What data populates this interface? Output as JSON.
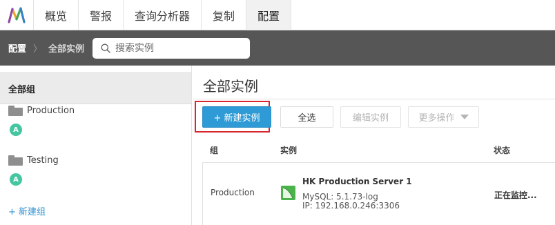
{
  "nav": {
    "tabs": [
      "概览",
      "警报",
      "查询分析器",
      "复制",
      "配置"
    ],
    "active_index": 4
  },
  "subbar": {
    "crumb_root": "配置",
    "crumb_sep": "〉",
    "crumb_current": "全部实例",
    "search_placeholder": "搜索实例"
  },
  "sidebar": {
    "all_groups": "全部组",
    "groups": [
      {
        "name": "Production",
        "avatar": "A"
      },
      {
        "name": "Testing",
        "avatar": "A"
      }
    ],
    "new_group": "+ 新建组"
  },
  "main": {
    "title": "全部实例",
    "buttons": {
      "new_instance": "+ 新建实例",
      "select_all": "全选",
      "edit_instance": "编辑实例",
      "more_actions": "更多操作"
    },
    "columns": {
      "group": "组",
      "instance": "实例",
      "status": "状态"
    },
    "rows": [
      {
        "group": "Production",
        "name": "HK Production Server 1",
        "version": "MySQL: 5.1.73-log",
        "ip": "IP: 192.168.0.246:3306",
        "status": "正在监控..."
      }
    ]
  },
  "colors": {
    "primary_button": "#2f9bd6",
    "highlight_box": "#d9262c",
    "avatar": "#44c6a0",
    "link": "#2d8fd0",
    "subbar": "#565656",
    "db_icon": "#4ab34a"
  },
  "icons": [
    "app-logo-icon",
    "search-icon",
    "folder-icon",
    "chevron-down-icon",
    "mysql-db-icon"
  ]
}
